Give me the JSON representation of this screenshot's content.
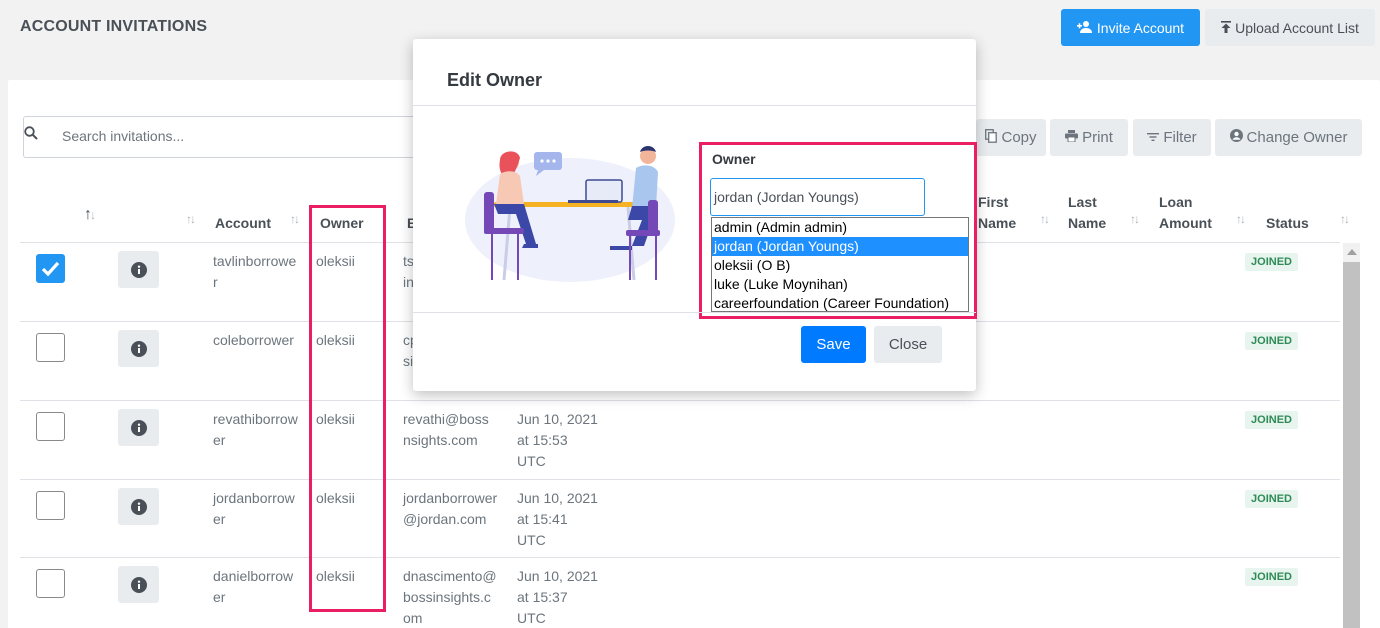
{
  "header": {
    "title": "ACCOUNT INVITATIONS",
    "invite_label": "Invite Account",
    "upload_label": "Upload Account List"
  },
  "toolbar": {
    "search_placeholder": "Search invitations...",
    "copy_label": "Copy",
    "print_label": "Print",
    "filter_label": "Filter",
    "change_owner_label": "Change Owner"
  },
  "table": {
    "headers": {
      "account": "Account",
      "owner": "Owner",
      "email_partial": "E",
      "first_name_1": "First",
      "first_name_2": "Name",
      "last_name_1": "Last",
      "last_name_2": "Name",
      "loan_amount_1": "Loan",
      "loan_amount_2": "Amount",
      "status": "Status"
    },
    "rows": [
      {
        "checked": true,
        "account_1": "tavlinborrowe",
        "account_2": "r",
        "owner": "oleksii",
        "email_1": "ts",
        "email_2": "in",
        "email_3": "",
        "date_1": "",
        "date_2": "",
        "date_3": "",
        "status": "JOINED"
      },
      {
        "checked": false,
        "account_1": "coleborrower",
        "account_2": "",
        "owner": "oleksii",
        "email_1": "cp",
        "email_2": "si",
        "email_3": "",
        "date_1": "",
        "date_2": "",
        "date_3": "",
        "status": "JOINED"
      },
      {
        "checked": false,
        "account_1": "revathiborrow",
        "account_2": "er",
        "owner": "oleksii",
        "email_1": "revathi@boss",
        "email_2": "nsights.com",
        "email_3": "",
        "date_1": "Jun 10, 2021",
        "date_2": "at 15:53",
        "date_3": "UTC",
        "status": "JOINED"
      },
      {
        "checked": false,
        "account_1": "jordanborrow",
        "account_2": "er",
        "owner": "oleksii",
        "email_1": "jordanborrower",
        "email_2": "@jordan.com",
        "email_3": "",
        "date_1": "Jun 10, 2021",
        "date_2": "at 15:41",
        "date_3": "UTC",
        "status": "JOINED"
      },
      {
        "checked": false,
        "account_1": "danielborrow",
        "account_2": "er",
        "owner": "oleksii",
        "email_1": "dnascimento@",
        "email_2": "bossinsights.c",
        "email_3": "om",
        "date_1": "Jun 10, 2021",
        "date_2": "at 15:37",
        "date_3": "UTC",
        "status": "JOINED"
      }
    ]
  },
  "modal": {
    "title": "Edit Owner",
    "owner_label": "Owner",
    "owner_value": "jordan (Jordan Youngs)",
    "options": [
      "admin (Admin admin)",
      "jordan (Jordan Youngs)",
      "oleksii (O B)",
      "luke (Luke Moynihan)",
      "careerfoundation (Career Foundation)"
    ],
    "selected_index": 1,
    "save_label": "Save",
    "close_label": "Close"
  },
  "colors": {
    "primary": "#2196f3",
    "save": "#007bff",
    "highlight": "#e91e63",
    "status_green": "#2e8b57"
  }
}
